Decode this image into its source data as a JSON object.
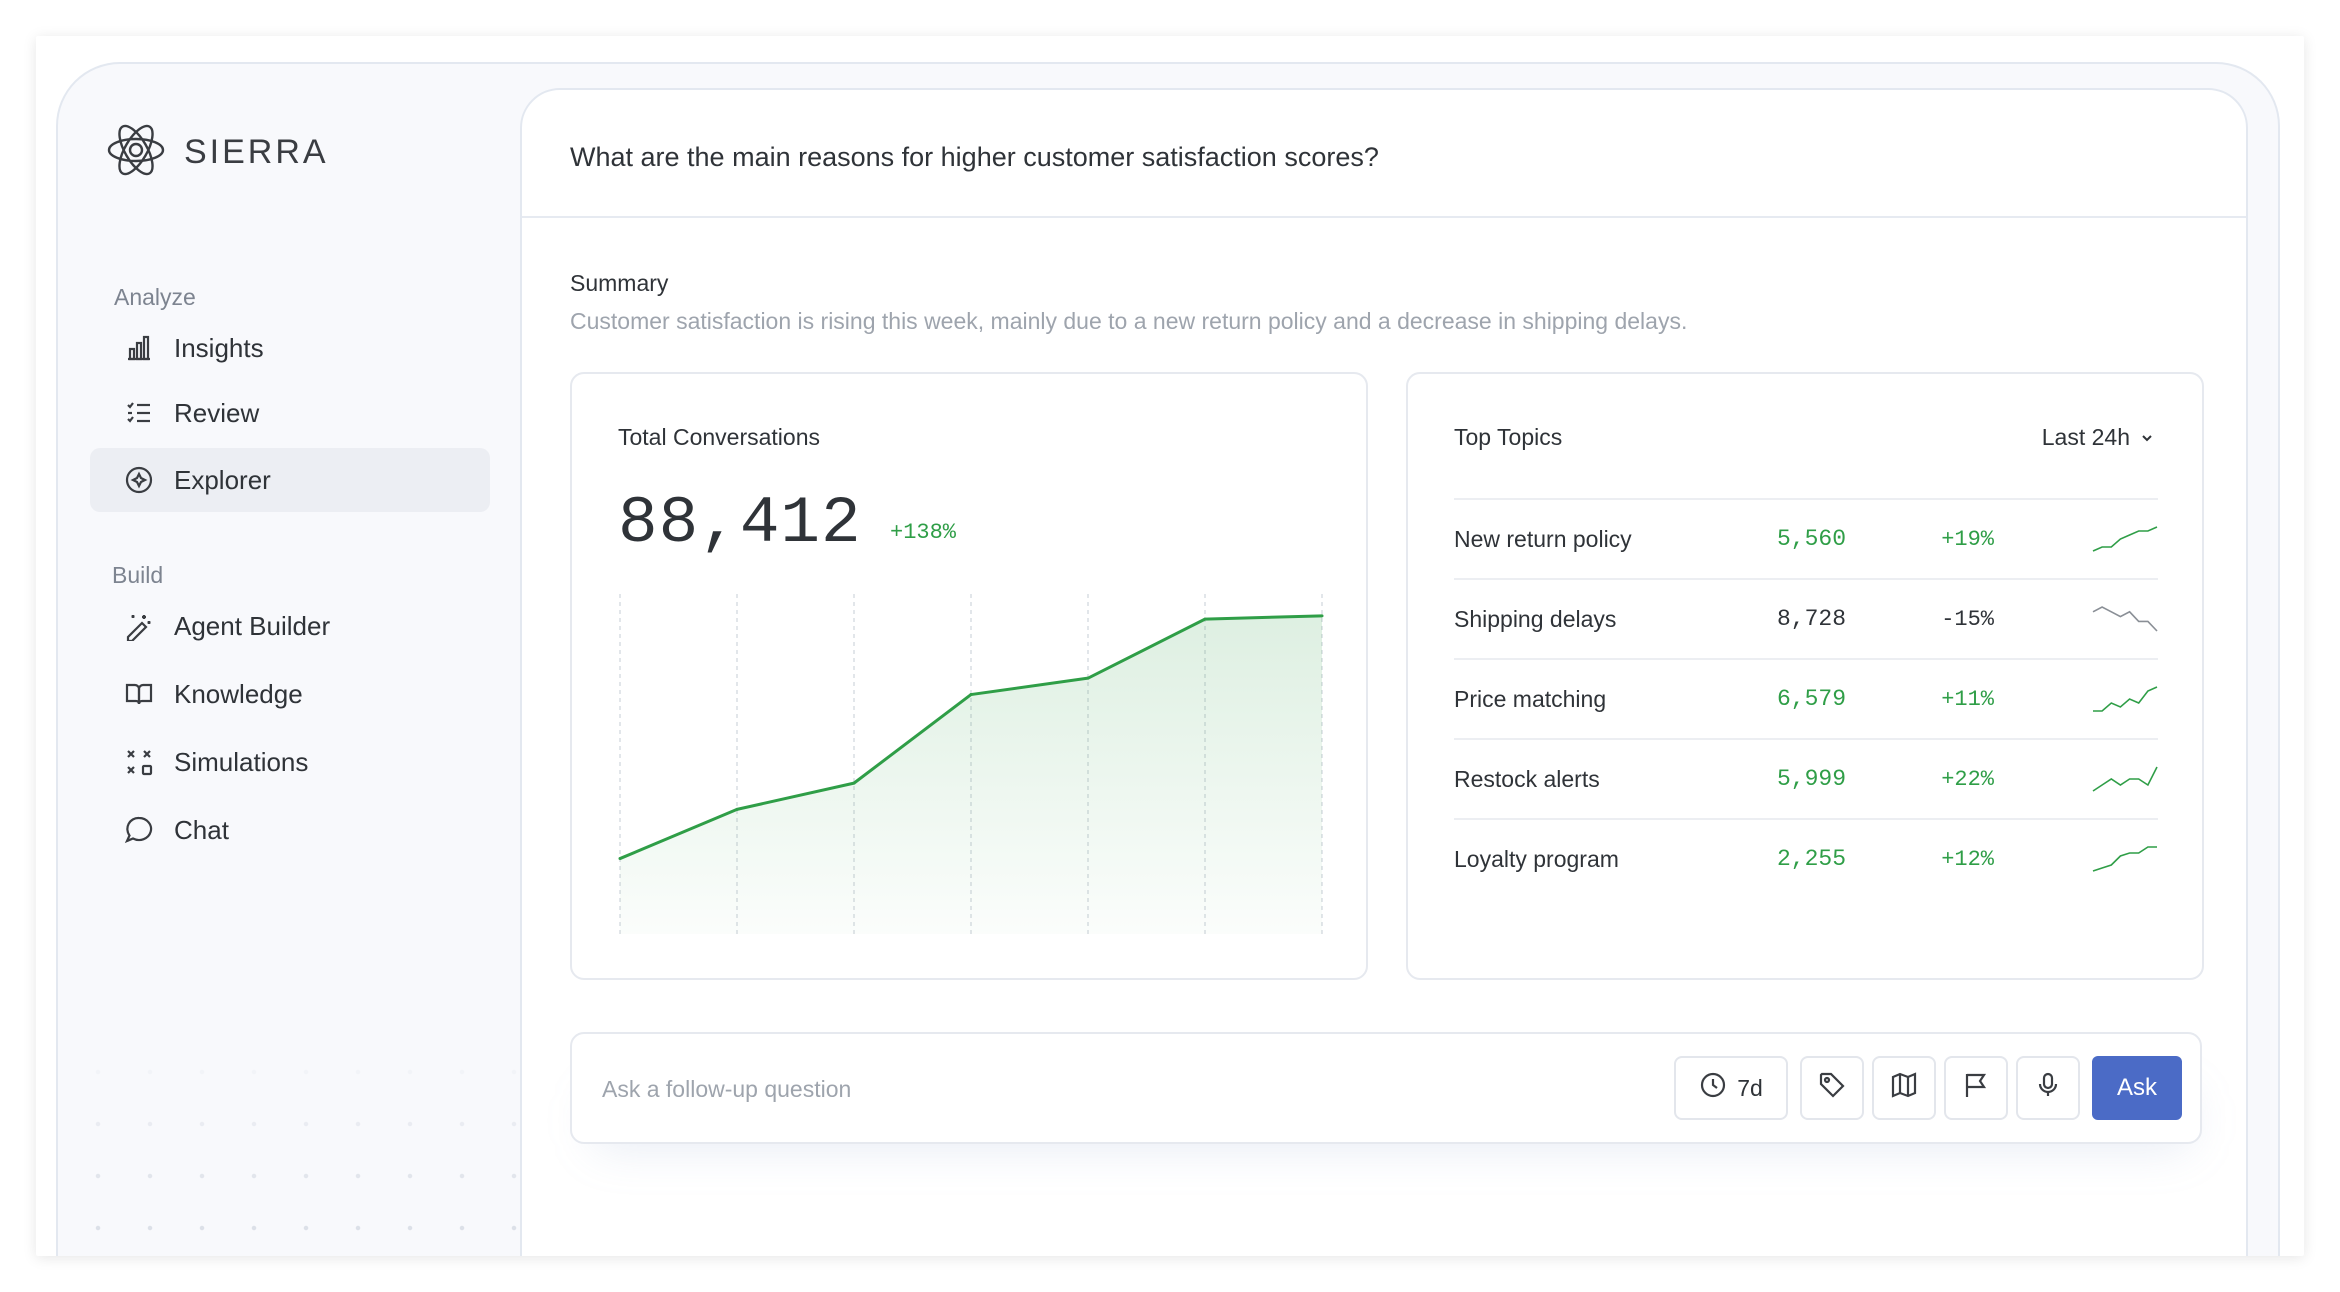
{
  "brand": {
    "name": "SIERRA"
  },
  "sidebar": {
    "analyze_label": "Analyze",
    "build_label": "Build",
    "analyze_items": [
      {
        "label": "Insights",
        "icon": "bar-chart-icon"
      },
      {
        "label": "Review",
        "icon": "checklist-icon"
      },
      {
        "label": "Explorer",
        "icon": "compass-icon",
        "active": true
      }
    ],
    "build_items": [
      {
        "label": "Agent Builder",
        "icon": "magic-wand-icon"
      },
      {
        "label": "Knowledge",
        "icon": "book-icon"
      },
      {
        "label": "Simulations",
        "icon": "simulation-icon"
      },
      {
        "label": "Chat",
        "icon": "chat-bubble-icon"
      }
    ]
  },
  "main": {
    "question": "What are the main reasons for higher customer satisfaction scores?",
    "summary_title": "Summary",
    "summary_text": "Customer satisfaction is rising this week, mainly due to a new return policy and a decrease in shipping delays."
  },
  "conversations": {
    "title": "Total Conversations",
    "value": "88,412",
    "change": "+138%",
    "color": "#2f9e47"
  },
  "chart_data": {
    "type": "area",
    "title": "Total Conversations",
    "x": [
      0,
      1,
      2,
      3,
      4,
      5,
      6
    ],
    "values": [
      23,
      38,
      46,
      73,
      78,
      96,
      97
    ],
    "ylim": [
      0,
      100
    ],
    "grid": "vertical dashed",
    "line_color": "#2f9e47"
  },
  "topics": {
    "title": "Top Topics",
    "range": "Last 24h",
    "rows": [
      {
        "name": "New return policy",
        "count": "5,560",
        "change": "+19%",
        "trend": "up",
        "spark": [
          2,
          3,
          3,
          5,
          6,
          7,
          7,
          8
        ]
      },
      {
        "name": "Shipping delays",
        "count": "8,728",
        "change": "-15%",
        "trend": "down",
        "spark": [
          7,
          8,
          7,
          6,
          7,
          5,
          5,
          3
        ]
      },
      {
        "name": "Price matching",
        "count": "6,579",
        "change": "+11%",
        "trend": "up",
        "spark": [
          2,
          2,
          4,
          3,
          5,
          4,
          7,
          8
        ]
      },
      {
        "name": "Restock alerts",
        "count": "5,999",
        "change": "+22%",
        "trend": "up",
        "spark": [
          3,
          4,
          5,
          4,
          5,
          5,
          4,
          7
        ]
      },
      {
        "name": "Loyalty program",
        "count": "2,255",
        "change": "+12%",
        "trend": "up",
        "spark": [
          1,
          2,
          3,
          6,
          7,
          7,
          9,
          9
        ]
      }
    ],
    "up_color": "#2f9e47",
    "down_color": "#2f3338"
  },
  "ask": {
    "placeholder": "Ask a follow-up question",
    "time_label": "7d",
    "ask_label": "Ask",
    "accent": "#4b6bc6"
  }
}
